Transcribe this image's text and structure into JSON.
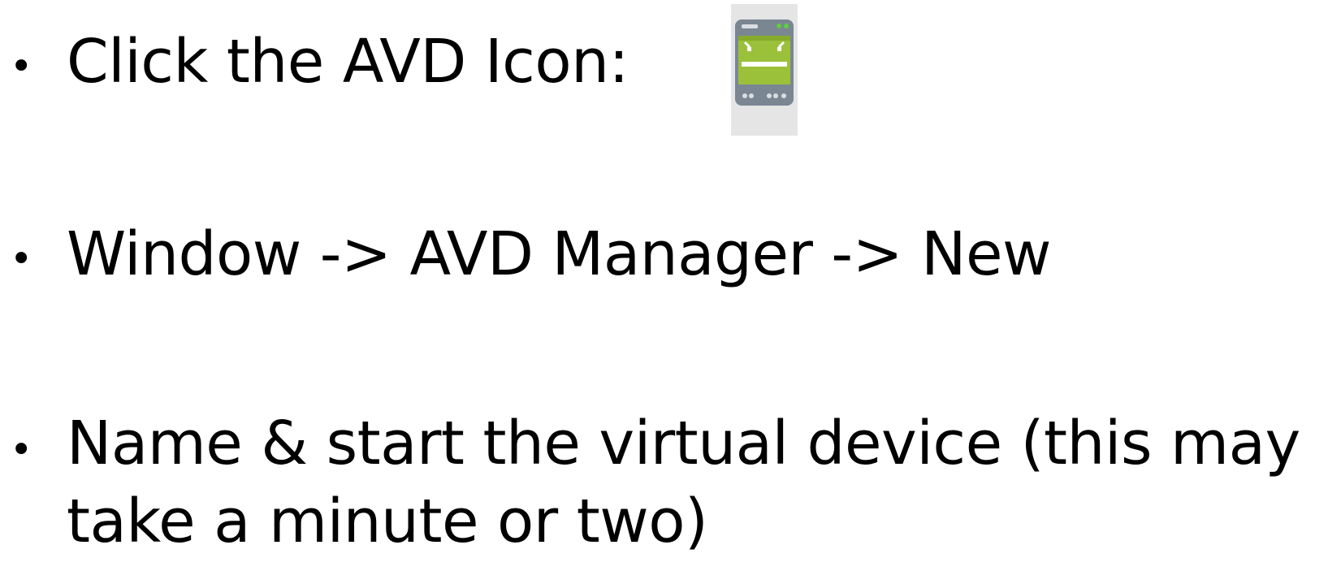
{
  "bullets": [
    {
      "text": "Click the AVD Icon:"
    },
    {
      "text": "Window -> AVD Manager -> New"
    },
    {
      "text_line1": "Name & start the virtual device (this may",
      "text_line2": "take a minute or two)"
    }
  ],
  "bullet_glyph": "•",
  "icons": {
    "avd": "avd-manager-icon"
  },
  "colors": {
    "android_green": "#9bc13a",
    "device_gray": "#7a8793",
    "icon_background": "#e5e5e5"
  }
}
